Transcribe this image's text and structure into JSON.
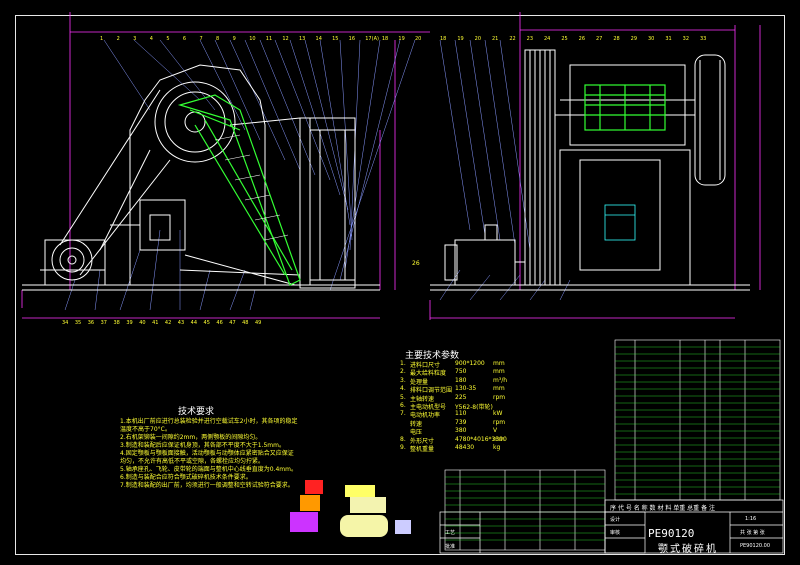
{
  "drawing": {
    "left_balloons": [
      "1",
      "2",
      "3",
      "4",
      "5",
      "6",
      "7",
      "8",
      "9",
      "10",
      "11",
      "12",
      "13",
      "14",
      "15",
      "16",
      "17(A)",
      "18",
      "19",
      "20"
    ],
    "right_balloons": [
      "18",
      "19",
      "20",
      "21",
      "22",
      "23",
      "24",
      "25",
      "26",
      "27",
      "28",
      "29",
      "30",
      "31",
      "32",
      "33"
    ],
    "bottom_left_balloons": [
      "34",
      "35",
      "36",
      "37",
      "38",
      "39",
      "40",
      "41",
      "42",
      "43",
      "44",
      "45",
      "46",
      "47",
      "48",
      "49"
    ],
    "side_balloon": "26"
  },
  "params": {
    "title": "主要技术参数",
    "rows": [
      {
        "no": "1.",
        "label": "进料口尺寸",
        "value": "900*1200",
        "unit": "mm"
      },
      {
        "no": "2.",
        "label": "最大给料粒度",
        "value": "750",
        "unit": "mm"
      },
      {
        "no": "3.",
        "label": "处理量",
        "value": "180",
        "unit": "m³/h"
      },
      {
        "no": "4.",
        "label": "排料口调节范围",
        "value": "130-35",
        "unit": "mm"
      },
      {
        "no": "5.",
        "label": "主轴转速",
        "value": "225",
        "unit": "rpm"
      },
      {
        "no": "6.",
        "label": "主电动机型号",
        "value": "Y562-8(带轮)",
        "unit": ""
      },
      {
        "no": "7.",
        "label": "电动机功率",
        "value": "110",
        "unit": "kW"
      },
      {
        "no": "",
        "label": "转速",
        "value": "739",
        "unit": "rpm"
      },
      {
        "no": "",
        "label": "电压",
        "value": "380",
        "unit": "V"
      },
      {
        "no": "8.",
        "label": "外形尺寸",
        "value": "4780*4016*3390",
        "unit": "mm"
      },
      {
        "no": "9.",
        "label": "整机重量",
        "value": "48430",
        "unit": "kg"
      }
    ]
  },
  "tech": {
    "title": "技术要求",
    "lines": [
      "1.本机出厂前应进行总装检验并进行空载试车2小时，其各项的稳定",
      "   温度不高于70°C。",
      "2.右机架铆装一间隙约2mm，两侧颚板的间隙均匀。",
      "3.制造和装配后应保证机身顶，其各部不平度不大于1.5mm。",
      "4.固定颚板与颚板面接触，活动颚板与动颚体应紧密贴合又应保证",
      "   均匀，不允许有高低不平或空隙，各螺栓应均匀拧紧。",
      "5.轴承座孔、飞轮、皮带轮的端面与整机中心线垂直度为0.4mm。",
      "6.制造与装配合应符合颚式破碎机技术条件要求。",
      "7.制造和装配的出厂前，均须进行一般调整和空转试验符合要求。"
    ]
  },
  "title_block": {
    "model": "PE90120",
    "name": "颚式破碎机",
    "scale": "1:16",
    "sheet": "共 张 第 张",
    "drawing_no": "PE90120.00",
    "row_label_1": "设计",
    "row_label_2": "审核",
    "row_label_3": "工艺",
    "row_label_4": "批准",
    "header": "序 代 号 名 称 数 材 料 单重 总重 备 注"
  },
  "colors": {
    "frame": "#e8e8e8",
    "outline": "#ffffff",
    "jaw": "#33ff33",
    "dim": "#ff33ff",
    "leader": "#8899ff",
    "text": "#ffff33",
    "cyan": "#33ffff"
  }
}
